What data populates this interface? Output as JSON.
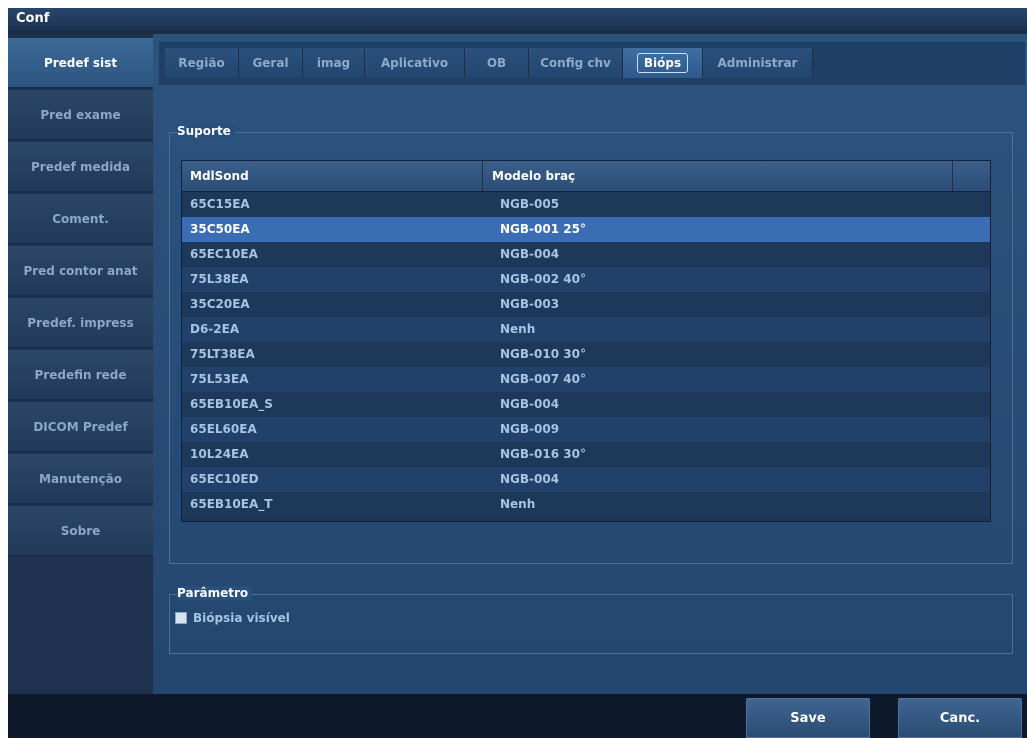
{
  "window": {
    "title": "Conf"
  },
  "sidebar": {
    "items": [
      {
        "label": "Predef sist",
        "active": true
      },
      {
        "label": "Pred exame"
      },
      {
        "label": "Predef medida"
      },
      {
        "label": "Coment."
      },
      {
        "label": "Pred contor anat"
      },
      {
        "label": "Predef. impress"
      },
      {
        "label": "Predefin rede"
      },
      {
        "label": "DICOM Predef"
      },
      {
        "label": "Manutenção"
      },
      {
        "label": "Sobre"
      }
    ]
  },
  "tabs": [
    {
      "label": "Região"
    },
    {
      "label": "Geral"
    },
    {
      "label": "imag"
    },
    {
      "label": "Aplicativo"
    },
    {
      "label": "OB"
    },
    {
      "label": "Config chv"
    },
    {
      "label": "Bióps",
      "active": true
    },
    {
      "label": "Administrar"
    }
  ],
  "suporte": {
    "title": "Suporte",
    "columns": [
      "MdlSond",
      "Modelo braç"
    ],
    "rows": [
      {
        "probe": "65C15EA",
        "model": "NGB-005"
      },
      {
        "probe": "35C50EA",
        "model": "NGB-001 25°",
        "selected": true
      },
      {
        "probe": "65EC10EA",
        "model": "NGB-004"
      },
      {
        "probe": "75L38EA",
        "model": "NGB-002 40°"
      },
      {
        "probe": "35C20EA",
        "model": "NGB-003"
      },
      {
        "probe": "D6-2EA",
        "model": "Nenh"
      },
      {
        "probe": "75LT38EA",
        "model": "NGB-010 30°"
      },
      {
        "probe": "75L53EA",
        "model": "NGB-007 40°"
      },
      {
        "probe": "65EB10EA_S",
        "model": "NGB-004"
      },
      {
        "probe": "65EL60EA",
        "model": "NGB-009"
      },
      {
        "probe": "10L24EA",
        "model": "NGB-016 30°"
      },
      {
        "probe": "65EC10ED",
        "model": "NGB-004"
      },
      {
        "probe": "65EB10EA_T",
        "model": "Nenh"
      }
    ]
  },
  "parametro": {
    "title": "Parâmetro",
    "biopsy_visible_label": "Biópsia visível",
    "biopsy_visible_checked": false
  },
  "footer": {
    "save_label": "Save",
    "cancel_label": "Canc."
  }
}
